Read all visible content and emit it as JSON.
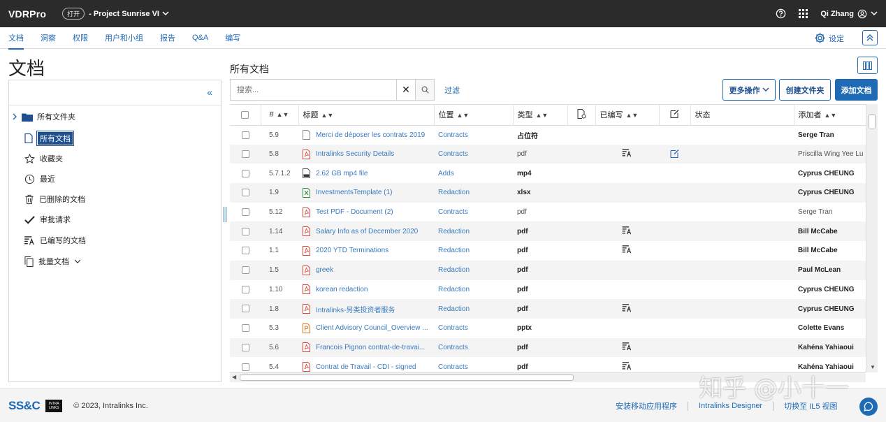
{
  "topbar": {
    "brand": "VDRPro",
    "status": "打开",
    "project": "- Project Sunrise VI",
    "user": "Qi Zhang"
  },
  "nav": {
    "tabs": [
      "文档",
      "洞察",
      "权限",
      "用户和小组",
      "报告",
      "Q&A",
      "编写"
    ],
    "active": "文档",
    "settings": "设定"
  },
  "left": {
    "page_title": "文档",
    "root": "所有文件夹",
    "items": [
      {
        "label": "所有文档",
        "icon": "document-icon",
        "selected": true
      },
      {
        "label": "收藏夹",
        "icon": "star-icon"
      },
      {
        "label": "最近",
        "icon": "clock-icon"
      },
      {
        "label": "已删除的文档",
        "icon": "trash-icon"
      },
      {
        "label": "审批请求",
        "icon": "checkmark-icon"
      },
      {
        "label": "已编写的文档",
        "icon": "redact-icon"
      },
      {
        "label": "批量文档",
        "icon": "copy-icon",
        "has_chevron": true
      }
    ]
  },
  "main": {
    "title": "所有文档",
    "search_placeholder": "搜索...",
    "filter": "过滤",
    "buttons": {
      "more_actions": "更多操作",
      "create_folder": "创建文件夹",
      "add_doc": "添加文档"
    },
    "columns": {
      "num": "#",
      "title": "标题",
      "location": "位置",
      "type": "类型",
      "redacted": "已编写",
      "status": "状态",
      "added_by": "添加者"
    },
    "rows": [
      {
        "num": "5.9",
        "title": "Merci de déposer les contrats 2019",
        "icon": "generic",
        "location": "Contracts",
        "type": "占位符",
        "type_bold": true,
        "redacted": false,
        "note": false,
        "owner": "Serge Tran",
        "owner_bold": true
      },
      {
        "num": "5.8",
        "title": "Intralinks Security Details",
        "icon": "pdf",
        "location": "Contracts",
        "type": "pdf",
        "type_bold": false,
        "redacted": true,
        "note": true,
        "owner": "Priscilla Wing Yee Lu",
        "owner_bold": false
      },
      {
        "num": "5.7.1.2",
        "title": "2.62 GB mp4 file",
        "icon": "mp4",
        "location": "Adds",
        "type": "mp4",
        "type_bold": true,
        "redacted": false,
        "note": false,
        "owner": "Cyprus CHEUNG",
        "owner_bold": true
      },
      {
        "num": "1.9",
        "title": "InvestmentsTemplate (1)",
        "icon": "xlsx",
        "location": "Redaction",
        "type": "xlsx",
        "type_bold": true,
        "redacted": false,
        "note": false,
        "owner": "Cyprus CHEUNG",
        "owner_bold": true
      },
      {
        "num": "5.12",
        "title": "Test PDF - Document (2)",
        "icon": "pdf",
        "location": "Contracts",
        "type": "pdf",
        "type_bold": false,
        "redacted": false,
        "note": false,
        "owner": "Serge Tran",
        "owner_bold": false
      },
      {
        "num": "1.14",
        "title": "Salary Info as of December 2020",
        "icon": "pdf",
        "location": "Redaction",
        "type": "pdf",
        "type_bold": true,
        "redacted": true,
        "note": false,
        "owner": "Bill McCabe",
        "owner_bold": true
      },
      {
        "num": "1.1",
        "title": "2020 YTD Terminations",
        "icon": "pdf",
        "location": "Redaction",
        "type": "pdf",
        "type_bold": true,
        "redacted": true,
        "note": false,
        "owner": "Bill McCabe",
        "owner_bold": true
      },
      {
        "num": "1.5",
        "title": "greek",
        "icon": "pdf",
        "location": "Redaction",
        "type": "pdf",
        "type_bold": true,
        "redacted": false,
        "note": false,
        "owner": "Paul McLean",
        "owner_bold": true
      },
      {
        "num": "1.10",
        "title": "korean redaction",
        "icon": "pdf",
        "location": "Redaction",
        "type": "pdf",
        "type_bold": true,
        "redacted": false,
        "note": false,
        "owner": "Cyprus CHEUNG",
        "owner_bold": true
      },
      {
        "num": "1.8",
        "title": "Intralinks-另类投资者服务",
        "icon": "pdf",
        "location": "Redaction",
        "type": "pdf",
        "type_bold": true,
        "redacted": true,
        "note": false,
        "owner": "Cyprus CHEUNG",
        "owner_bold": true
      },
      {
        "num": "5.3",
        "title": "Client Advisory Council_Overview ...",
        "icon": "pptx",
        "location": "Contracts",
        "type": "pptx",
        "type_bold": true,
        "redacted": false,
        "note": false,
        "owner": "Colette Evans",
        "owner_bold": true
      },
      {
        "num": "5.6",
        "title": "Francois Pignon contrat-de-travai...",
        "icon": "pdf",
        "location": "Contracts",
        "type": "pdf",
        "type_bold": true,
        "redacted": true,
        "note": false,
        "owner": "Kahéna Yahiaoui",
        "owner_bold": true
      },
      {
        "num": "5.4",
        "title": "Contrat de Travail - CDI - signed",
        "icon": "pdf",
        "location": "Contracts",
        "type": "pdf",
        "type_bold": true,
        "redacted": true,
        "note": false,
        "owner": "Kahéna Yahiaoui",
        "owner_bold": true
      }
    ]
  },
  "footer": {
    "copyright": "© 2023, Intralinks Inc.",
    "links": [
      "安装移动应用程序",
      "Intralinks Designer",
      "切换至 IL5 视图"
    ],
    "logo_text": "SS&C",
    "il_logo": "INTRA LINKS"
  },
  "watermark": "知乎 @小十一",
  "colors": {
    "accent": "#1e6ab5",
    "topbar": "#2b2b2b",
    "pdf": "#d9453c",
    "xlsx": "#2f8f3a",
    "pptx": "#d87a1e"
  }
}
